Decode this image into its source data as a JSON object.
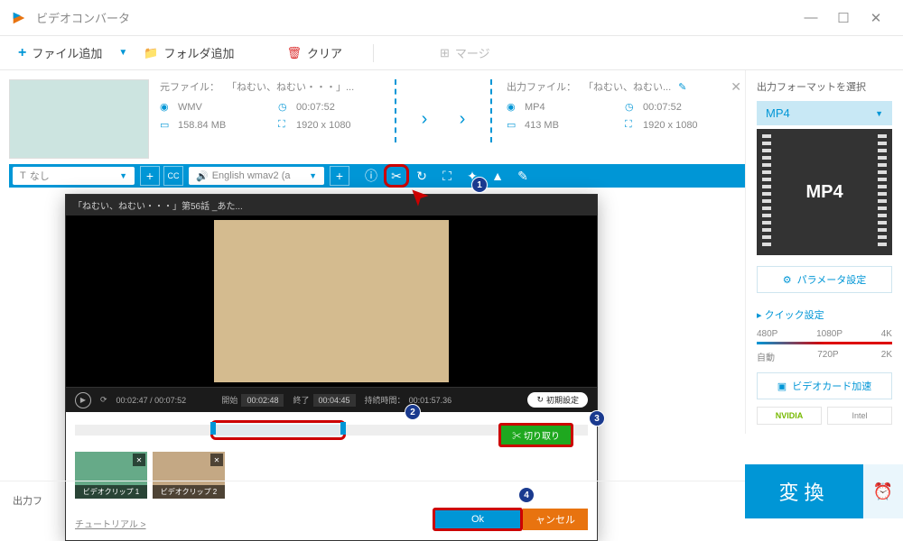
{
  "titlebar": {
    "title": "ビデオコンバータ"
  },
  "toolbar": {
    "add_file": "ファイル追加",
    "add_folder": "フォルダ追加",
    "clear": "クリア",
    "merge": "マージ"
  },
  "file": {
    "source_label": "元ファイル：",
    "source_name": "「ねむい、ねむい・・・」...",
    "output_label": "出力ファイル：",
    "output_name": "「ねむい、ねむい...",
    "src_fmt": "WMV",
    "src_dur": "00:07:52",
    "src_size": "158.84 MB",
    "src_res": "1920 x 1080",
    "out_fmt": "MP4",
    "out_dur": "00:07:52",
    "out_size": "413 MB",
    "out_res": "1920 x 1080"
  },
  "editbar": {
    "subtitle_none": "なし",
    "audio_track": "English wmav2 (a"
  },
  "dialog": {
    "title": "「ねむい、ねむい・・・」第56話 _あた...",
    "playtime": "00:02:47 / 00:07:52",
    "start_label": "開始",
    "start_val": "00:02:48",
    "end_label": "終了",
    "end_val": "00:04:45",
    "duration_label": "持続時間：",
    "duration_val": "00:01:57.36",
    "reset": "初期設定",
    "cut": "切り取り",
    "clip1": "ビデオクリップ 1",
    "clip2": "ビデオクリップ 2",
    "tutorial": "チュートリアル >",
    "ok": "Ok",
    "cancel": "ャンセル"
  },
  "sidebar": {
    "select_format": "出力フォーマットを選択",
    "format": "MP4",
    "param": "パラメータ設定",
    "quick": "クイック設定",
    "q480": "480P",
    "q720": "720P",
    "q1080": "1080P",
    "q2k": "2K",
    "q4k": "4K",
    "auto": "自動",
    "gpu": "ビデオカード加速",
    "nvidia": "NVIDIA",
    "intel": "Intel"
  },
  "bottom": {
    "out_label": "出力フ"
  },
  "convert": {
    "label": "変換"
  },
  "anno": {
    "b1": "1",
    "b2": "2",
    "b3": "3",
    "b4": "4"
  }
}
